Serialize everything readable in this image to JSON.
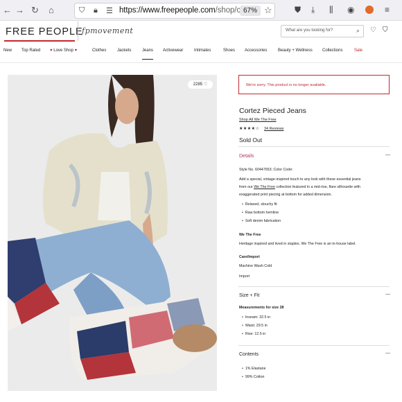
{
  "browser": {
    "url_host": "https://www.freepeople.com",
    "url_path": "/shop/c",
    "zoom": "67%"
  },
  "site": {
    "logo": "FREE PEOPLE",
    "sub_brand": "fpmovement",
    "search_placeholder": "What are you looking for?"
  },
  "nav": [
    {
      "label": "New"
    },
    {
      "label": "Top Rated"
    },
    {
      "label": "Love Shop"
    },
    {
      "label": "Clothes"
    },
    {
      "label": "Jackets"
    },
    {
      "label": "Jeans"
    },
    {
      "label": "Activewear"
    },
    {
      "label": "Intimates"
    },
    {
      "label": "Shoes"
    },
    {
      "label": "Accessories"
    },
    {
      "label": "Beauty + Wellness"
    },
    {
      "label": "Collections"
    },
    {
      "label": "Sale"
    }
  ],
  "product": {
    "likes": "2285",
    "alert": "We're sorry. This product is no longer available.",
    "title": "Cortez Pieced Jeans",
    "brand": "Shop All We The Free",
    "rating_stars": "★★★★☆",
    "rating": 4,
    "reviews": "34 Reviews",
    "status": "Sold Out"
  },
  "details": {
    "heading": "Details",
    "style_no": "Style No. 60447653; Color Code:",
    "desc_1": "Add a special, vintage-inspired touch to any look with these essential jeans",
    "desc_2a": "from our ",
    "desc_2_link": "We The Free",
    "desc_2b": " collection featured in a mid-rise, flare silhouette with",
    "desc_3": "exaggerated print piecing at bottom for added dimension.",
    "bullets": [
      "Relaxed, slouchy fit",
      "Raw bottom hemline",
      "Soft denim fabrication"
    ],
    "wtf_heading": "We The Free",
    "wtf_text": "Heritage inspired and lived in staples. We The Free is an in-house label.",
    "care_heading": "Care/Import",
    "care": "Machine Wash Cold",
    "import": "Import"
  },
  "size_fit": {
    "heading": "Size + Fit",
    "measure_heading": "Measurements for size 28",
    "items": [
      "Inseam: 32.5 in",
      "Waist: 29.5 in",
      "Rise: 12.5 in"
    ]
  },
  "contents": {
    "heading": "Contents",
    "items": [
      "1% Elastane",
      "99% Cotton"
    ]
  }
}
